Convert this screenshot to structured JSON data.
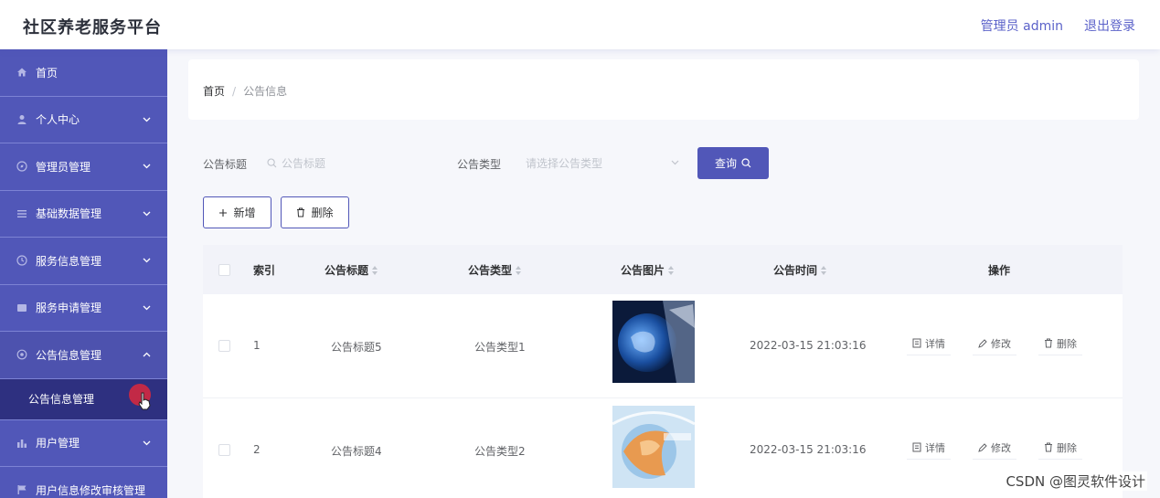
{
  "header": {
    "brand": "社区养老服务平台",
    "user": "管理员 admin",
    "logout": "退出登录"
  },
  "sidebar": {
    "items": [
      {
        "label": "首页",
        "icon": "home-icon",
        "has_chevron": false
      },
      {
        "label": "个人中心",
        "icon": "user-icon",
        "has_chevron": true
      },
      {
        "label": "管理员管理",
        "icon": "compass-icon",
        "has_chevron": true
      },
      {
        "label": "基础数据管理",
        "icon": "list-icon",
        "has_chevron": true
      },
      {
        "label": "服务信息管理",
        "icon": "clock-icon",
        "has_chevron": true
      },
      {
        "label": "服务申请管理",
        "icon": "card-icon",
        "has_chevron": true
      },
      {
        "label": "公告信息管理",
        "icon": "gear-icon",
        "has_chevron": true,
        "expanded": true
      },
      {
        "label": "用户管理",
        "icon": "chart-icon",
        "has_chevron": true
      },
      {
        "label": "用户信息修改审核管理",
        "icon": "flag-icon",
        "has_chevron": false
      }
    ],
    "submenu": {
      "label": "公告信息管理"
    }
  },
  "breadcrumb": {
    "home": "首页",
    "separator": "/",
    "current": "公告信息"
  },
  "search": {
    "title_label": "公告标题",
    "title_placeholder": "公告标题",
    "type_label": "公告类型",
    "type_placeholder": "请选择公告类型",
    "query_label": "查询"
  },
  "actions": {
    "add_label": "新增",
    "delete_label": "删除"
  },
  "table": {
    "columns": [
      "索引",
      "公告标题",
      "公告类型",
      "公告图片",
      "公告时间",
      "操作"
    ],
    "rows": [
      {
        "index": "1",
        "title": "公告标题5",
        "type": "公告类型1",
        "time": "2022-03-15 21:03:16"
      },
      {
        "index": "2",
        "title": "公告标题4",
        "type": "公告类型2",
        "time": "2022-03-15 21:03:16"
      }
    ],
    "ops": {
      "detail": "详情",
      "edit": "修改",
      "delete": "删除"
    }
  },
  "watermark": "CSDN @图灵软件设计",
  "colors": {
    "primary": "#5157b8",
    "sidebar_active": "#2e3080",
    "header_link": "#5b62c9"
  }
}
